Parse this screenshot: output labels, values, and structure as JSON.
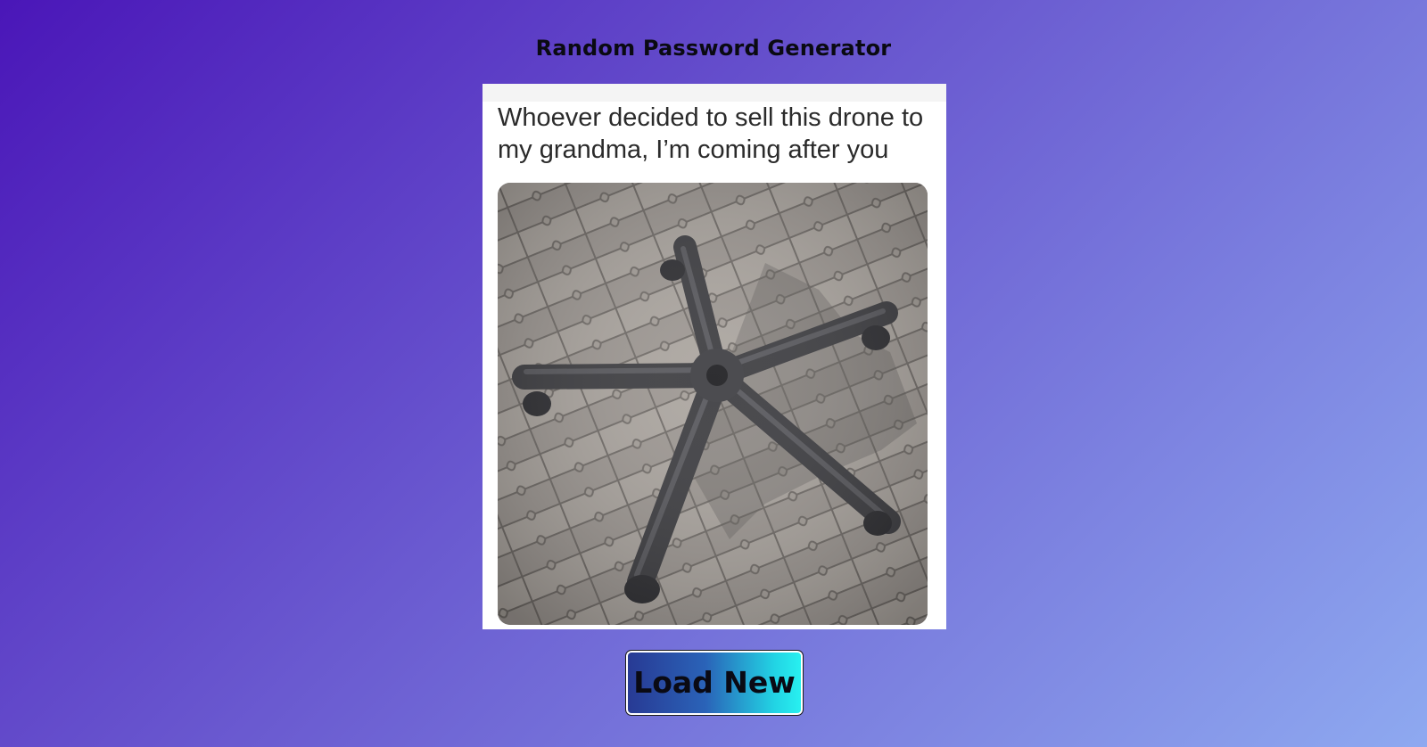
{
  "page": {
    "title": "Random Password Generator"
  },
  "meme": {
    "caption": "Whoever decided to sell this drone to my grandma, I’m coming after you",
    "image_subject": "office chair wheel base on paving stones"
  },
  "controls": {
    "load_button_label": "Load New"
  },
  "colors": {
    "background_start": "#4a16b8",
    "background_end": "#8ea9f0",
    "button_gradient_start": "#283a94",
    "button_gradient_end": "#28f0f0"
  }
}
